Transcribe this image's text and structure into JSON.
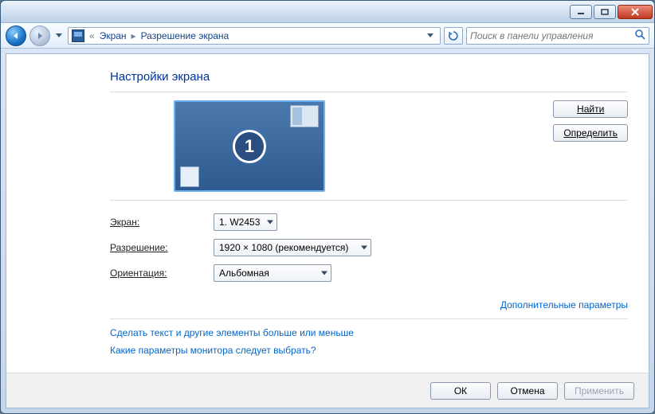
{
  "titlebar": {
    "min": "",
    "max": "",
    "close": ""
  },
  "breadcrumb": {
    "prefix": "«",
    "item1": "Экран",
    "item2": "Разрешение экрана"
  },
  "search": {
    "placeholder": "Поиск в панели управления"
  },
  "heading": "Настройки экрана",
  "preview": {
    "monitor_number": "1",
    "find": "Найти",
    "detect": "Определить"
  },
  "form": {
    "display_label": "Экран:",
    "display_value": "1. W2453",
    "resolution_label": "Разрешение:",
    "resolution_value": "1920 × 1080 (рекомендуется)",
    "orientation_label": "Ориентация:",
    "orientation_value": "Альбомная"
  },
  "links": {
    "advanced": "Дополнительные параметры",
    "text_size": "Сделать текст и другие элементы больше или меньше",
    "which_monitor": "Какие параметры монитора следует выбрать?"
  },
  "footer": {
    "ok": "ОК",
    "cancel": "Отмена",
    "apply": "Применить"
  }
}
